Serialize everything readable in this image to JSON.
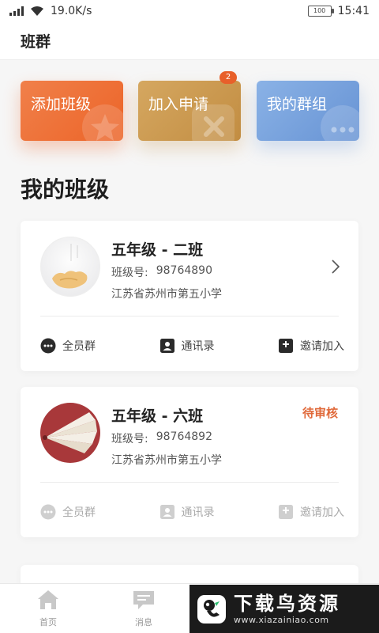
{
  "status_bar": {
    "speed": "19.0K/s",
    "battery": "100",
    "time": "15:41"
  },
  "header": {
    "title": "班群"
  },
  "actions": [
    {
      "label": "添加班级",
      "color": "#ec6428"
    },
    {
      "label": "加入申请",
      "color": "#c28d42",
      "badge": "2"
    },
    {
      "label": "我的群组",
      "color": "#6793d4"
    }
  ],
  "section_title": "我的班级",
  "classes": [
    {
      "grade": "五年级",
      "name": "二班",
      "number_label": "班级号:",
      "number": "98764890",
      "school": "江苏省苏州市第五小学",
      "status": "",
      "actions": [
        "全员群",
        "通讯录",
        "邀请加入"
      ]
    },
    {
      "grade": "五年级",
      "name": "六班",
      "number_label": "班级号:",
      "number": "98764892",
      "school": "江苏省苏州市第五小学",
      "status": "待审核",
      "status_color": "#e0693a",
      "actions": [
        "全员群",
        "通讯录",
        "邀请加入"
      ]
    }
  ],
  "tabs": [
    {
      "label": "首页",
      "icon": "home-icon"
    },
    {
      "label": "消息",
      "icon": "message-icon"
    }
  ],
  "watermark": {
    "text": "下载鸟资源",
    "url": "www.xiazainiao.com"
  }
}
